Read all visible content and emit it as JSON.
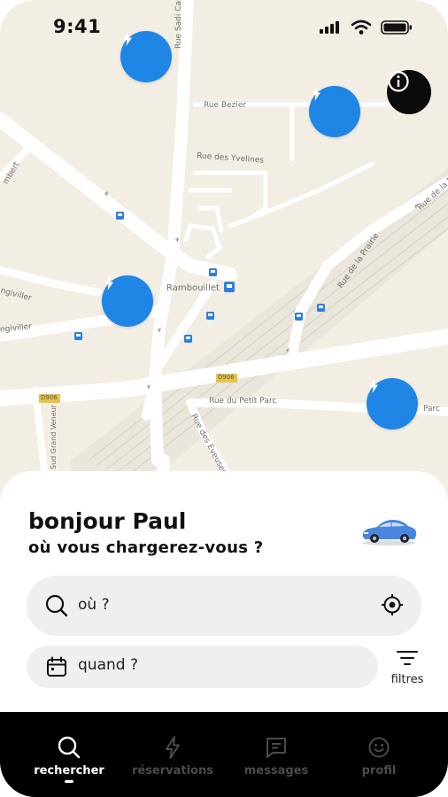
{
  "status_bar": {
    "time": "9:41"
  },
  "map": {
    "street_labels": [
      "Rue Sadi Carnot",
      "Rue Bezier",
      "Rue des Yvelines",
      "Rambouillet",
      "Rue de la Prairie",
      "Rue de la P",
      "Rue du Petit Parc",
      "Rue des Eveuses",
      "Parc",
      "D906",
      "Sud Grand Veneur",
      "mbert",
      "ngiviller",
      "ngiviller"
    ],
    "road_badges": [
      "D906",
      "D906"
    ],
    "pins": [
      "charging-station",
      "charging-station",
      "charging-station",
      "charging-station"
    ],
    "info_icon": "info-icon"
  },
  "sheet": {
    "greeting": "bonjour Paul",
    "question": "où vous chargerez-vous ?",
    "search": {
      "placeholder": "où ?"
    },
    "date": {
      "placeholder": "quand ?"
    },
    "filters_label": "filtres"
  },
  "nav": {
    "items": [
      {
        "label": "rechercher",
        "icon": "search-icon",
        "active": true
      },
      {
        "label": "réservations",
        "icon": "lightning-icon",
        "active": false
      },
      {
        "label": "messages",
        "icon": "message-icon",
        "active": false
      },
      {
        "label": "profil",
        "icon": "smiley-icon",
        "active": false
      }
    ]
  },
  "colors": {
    "pin": "#1f86e6",
    "nav_bg": "#000000",
    "input_bg": "#efefef",
    "map_bg": "#f2eee4"
  }
}
